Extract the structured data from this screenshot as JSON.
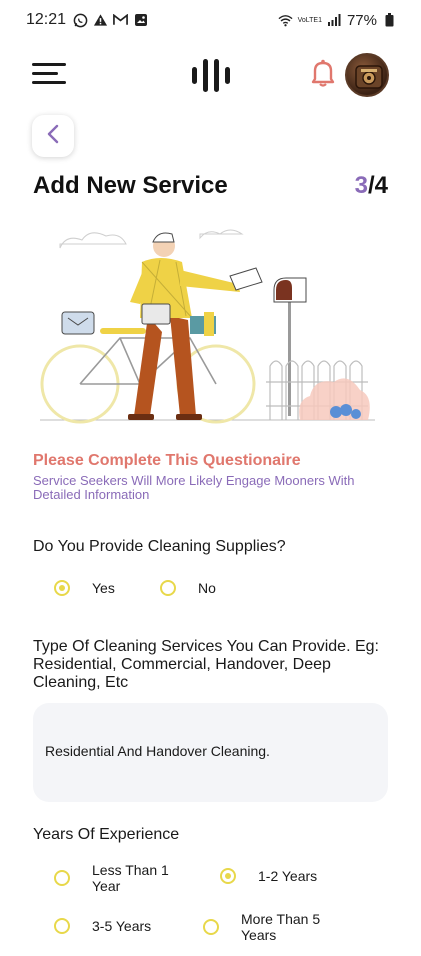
{
  "status_bar": {
    "time": "12:21",
    "network_label": "VoLTE1",
    "battery": "77%"
  },
  "colors": {
    "accent_purple": "#8a6bb8",
    "heading_coral": "#e0776d",
    "radio_yellow": "#e8d84a",
    "field_bg": "#f4f5f8"
  },
  "icons": {
    "menu": "hamburger-menu-icon",
    "logo": "brand-logo-icon",
    "notification": "bell-icon",
    "back": "chevron-left-icon"
  },
  "page": {
    "title": "Add New Service",
    "step_current": "3",
    "step_separator": "/",
    "step_total": "4"
  },
  "questionnaire": {
    "heading": "Please Complete This Questionaire",
    "subheading": "Service Seekers Will More Likely Engage Mooners With Detailed Information"
  },
  "supplies": {
    "question": "Do You Provide Cleaning Supplies?",
    "options": [
      {
        "label": "Yes",
        "selected": true
      },
      {
        "label": "No",
        "selected": false
      }
    ]
  },
  "service_types": {
    "question": "Type Of Cleaning Services You Can Provide. Eg: Residential, Commercial, Handover, Deep Cleaning, Etc",
    "value": "Residential And Handover Cleaning."
  },
  "experience": {
    "question": "Years Of Experience",
    "options": [
      {
        "label": "Less Than 1 Year",
        "selected": false
      },
      {
        "label": "1-2 Years",
        "selected": true
      },
      {
        "label": "3-5 Years",
        "selected": false
      },
      {
        "label": "More Than 5 Years",
        "selected": false
      }
    ]
  }
}
